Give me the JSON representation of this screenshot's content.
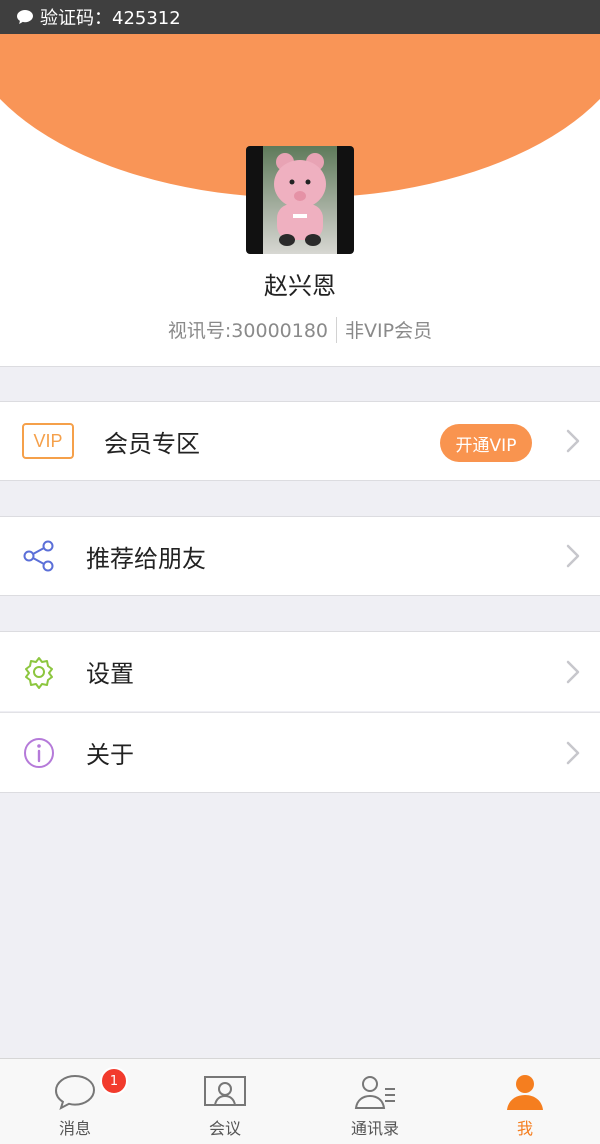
{
  "status_bar": {
    "text": "验证码：425312",
    "icon": "chat-bubble-icon"
  },
  "profile": {
    "name": "赵兴恩",
    "account_id": "视讯号:30000180",
    "membership": "非VIP会员",
    "accent_color": "#f99557"
  },
  "menu": {
    "vip": {
      "badge": "VIP",
      "label": "会员专区",
      "button": "开通VIP"
    },
    "share": {
      "label": "推荐给朋友",
      "icon": "share-icon"
    },
    "settings": {
      "label": "设置",
      "icon": "gear-icon"
    },
    "about": {
      "label": "关于",
      "icon": "info-icon"
    }
  },
  "tabs": [
    {
      "label": "消息",
      "icon": "chat-bubble-icon",
      "badge": "1"
    },
    {
      "label": "会议",
      "icon": "meeting-icon"
    },
    {
      "label": "通讯录",
      "icon": "contacts-icon"
    },
    {
      "label": "我",
      "icon": "person-icon",
      "active": true
    }
  ]
}
